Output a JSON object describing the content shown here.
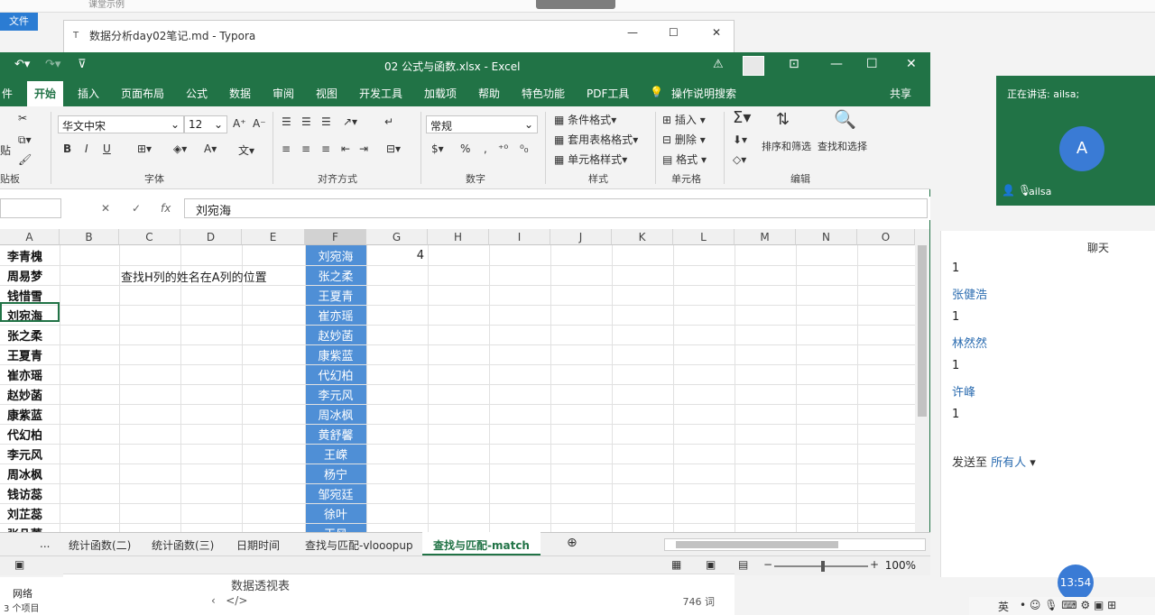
{
  "desktop": {
    "file_tab": "文件",
    "lesson_label": "课堂示例",
    "typora_title": "数据分析day02笔记.md - Typora",
    "typora_bottom_heading": "数据透视表",
    "typora_word_count": "746 词",
    "explorer_net": "网络",
    "explorer_count": "3 个项目"
  },
  "excel": {
    "title": "02 公式与函数.xlsx  -  Excel",
    "ribbon_tabs": [
      "件",
      "开始",
      "插入",
      "页面布局",
      "公式",
      "数据",
      "审阅",
      "视图",
      "开发工具",
      "加载项",
      "帮助",
      "特色功能",
      "PDF工具",
      "操作说明搜索",
      "共享"
    ],
    "active_tab": "开始",
    "ribbon": {
      "clipboard_label": "贴板",
      "paste_label": "贴",
      "font_name": "华文中宋",
      "font_size": "12",
      "font_group_label": "字体",
      "bold": "B",
      "italic": "I",
      "underline": "U",
      "align_group_label": "对齐方式",
      "number_format": "常规",
      "number_group_label": "数字",
      "cond_format": "条件格式",
      "table_format": "套用表格格式",
      "cell_style": "单元格样式",
      "style_group_label": "样式",
      "insert": "插入",
      "delete": "删除",
      "format": "格式",
      "cells_group_label": "单元格",
      "sort_filter": "排序和筛选",
      "find_select": "查找和选择",
      "edit_group_label": "编辑"
    },
    "formula_bar": {
      "fx": "fx",
      "content": "刘宛海"
    },
    "columns": [
      "A",
      "B",
      "C",
      "D",
      "E",
      "F",
      "G",
      "H",
      "I",
      "J",
      "K",
      "L",
      "M",
      "N",
      "O"
    ],
    "column_a": [
      "李青槐",
      "周易梦",
      "钱惜雪",
      "刘宛海",
      "张之柔",
      "王夏青",
      "崔亦瑶",
      "赵妙菡",
      "康紫蓝",
      "代幻柏",
      "李元风",
      "周冰枫",
      "钱访蕊",
      "刘芷蕊",
      "张凡蕾"
    ],
    "column_f": [
      "刘宛海",
      "张之柔",
      "王夏青",
      "崔亦瑶",
      "赵妙菡",
      "康紫蓝",
      "代幻柏",
      "李元风",
      "周冰枫",
      "黄舒馨",
      "王嵘",
      "杨宁",
      "邹宛廷",
      "徐叶",
      "王风"
    ],
    "g1_value": "4",
    "c2_note": "查找H列的姓名在A列的位置",
    "sheet_tabs": [
      "...",
      "统计函数(二)",
      "统计函数(三)",
      "日期时间",
      "查找与匹配-vlooopup",
      "查找与匹配-match"
    ],
    "active_sheet": "查找与匹配-match",
    "zoom": "100%"
  },
  "meeting": {
    "speaking": "正在讲话: ailsa;",
    "avatar_letter": "A",
    "user_name": "ailsa"
  },
  "chat": {
    "title": "聊天",
    "messages": [
      "1",
      "张健浩",
      "1",
      "林然然",
      "1",
      "许峰",
      "1"
    ],
    "send_to_label": "发送至",
    "send_to_target": "所有人"
  },
  "clock": "13:54",
  "tray_lang": "英"
}
